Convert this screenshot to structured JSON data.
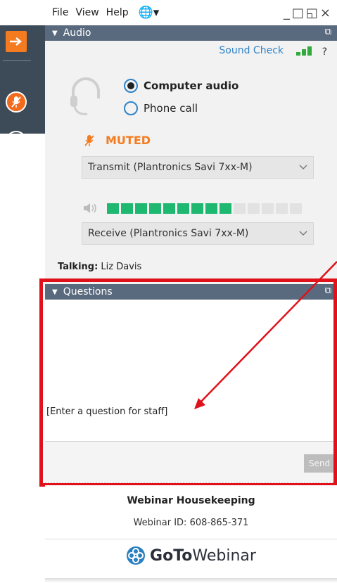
{
  "menubar": {
    "file": "File",
    "view": "View",
    "help": "Help",
    "globe_icon": "globe-icon",
    "window_controls": "_□◱×"
  },
  "audio_panel": {
    "header": "Audio",
    "sound_check": "Sound Check",
    "help": "?",
    "options": {
      "computer_audio": "Computer audio",
      "phone_call": "Phone call",
      "selected": "Computer audio"
    },
    "mic_status": "MUTED",
    "transmit_device": "Transmit (Plantronics Savi 7xx-M)",
    "receive_device": "Receive (Plantronics Savi 7xx-M)",
    "speaker_level": {
      "active_segments": 9,
      "total_segments": 14
    },
    "signal_bars": 3
  },
  "talking": {
    "label": "Talking:",
    "name": "Liz Davis"
  },
  "questions_panel": {
    "header": "Questions",
    "input_value": "[Enter a question for staff]",
    "send_label": "Send"
  },
  "footer": {
    "title": "Webinar Housekeeping",
    "webinar_id": "Webinar ID: 608-865-371",
    "brand_bold": "GoTo",
    "brand_light": "Webinar"
  },
  "colors": {
    "accent_orange": "#f47b20",
    "header_gray": "#5a6a7e",
    "link_blue": "#2f83c8",
    "meter_green": "#1fb870",
    "highlight_red": "#e0111a"
  }
}
